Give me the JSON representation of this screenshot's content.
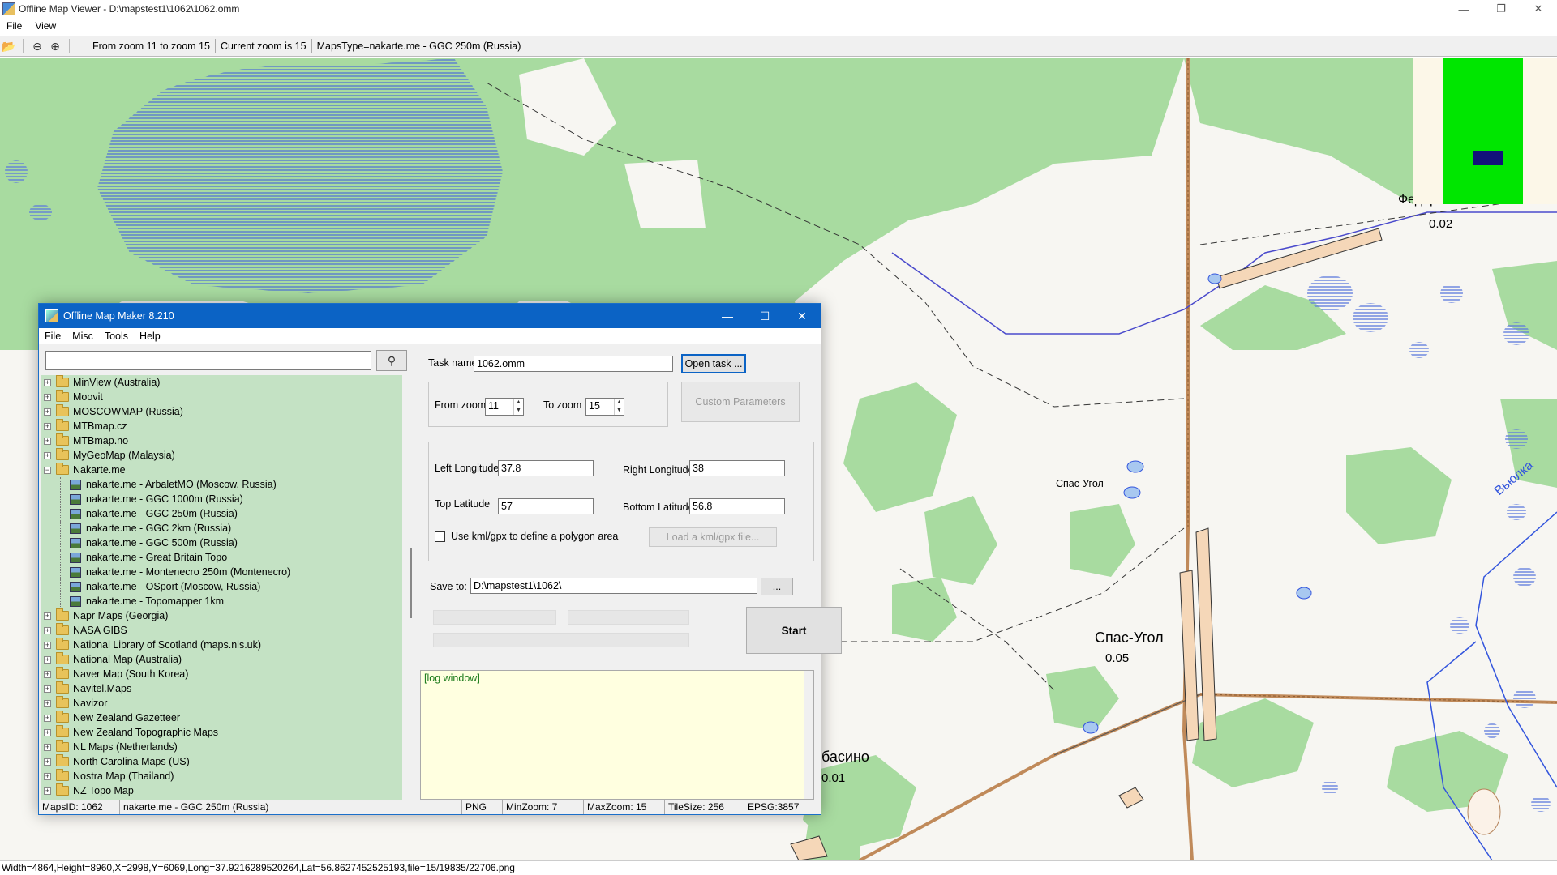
{
  "window": {
    "title": "Offline Map Viewer - D:\\mapstest1\\1062\\1062.omm",
    "controls": [
      "—",
      "❐",
      "✕"
    ]
  },
  "menu": [
    "File",
    "View"
  ],
  "toolbar": {
    "zoom_range": "From zoom 11 to zoom 15",
    "current_zoom": "Current zoom is 15",
    "maps_type": "MapsType=nakarte.me - GGC 250m (Russia)"
  },
  "status": "Width=4864,Height=8960,X=2998,Y=6069,Long=37.9216289520264,Lat=56.8627452525193,file=15/19835/22706.png",
  "map": {
    "labels": [
      {
        "text": "Федоровское"
      },
      {
        "text": "0.02"
      },
      {
        "text": "Спас-Угол"
      },
      {
        "text": "Спас-Угол"
      },
      {
        "text": "0.05"
      },
      {
        "text": "басино"
      },
      {
        "text": "0.01"
      },
      {
        "text": "Вьюлка"
      }
    ]
  },
  "dialog": {
    "title": "Offline Map Maker 8.210",
    "menu": [
      "File",
      "Misc",
      "Tools",
      "Help"
    ],
    "search_placeholder": "",
    "tree": [
      {
        "label": "MinView (Australia)",
        "type": "folder"
      },
      {
        "label": "Moovit",
        "type": "folder"
      },
      {
        "label": "MOSCOWMAP (Russia)",
        "type": "folder"
      },
      {
        "label": "MTBmap.cz",
        "type": "folder"
      },
      {
        "label": "MTBmap.no",
        "type": "folder"
      },
      {
        "label": "MyGeoMap (Malaysia)",
        "type": "folder"
      },
      {
        "label": "Nakarte.me",
        "type": "open"
      },
      {
        "label": "nakarte.me - ArbaletMO (Moscow, Russia)",
        "type": "map"
      },
      {
        "label": "nakarte.me - GGC 1000m (Russia)",
        "type": "map"
      },
      {
        "label": "nakarte.me - GGC 250m (Russia)",
        "type": "map"
      },
      {
        "label": "nakarte.me - GGC 2km (Russia)",
        "type": "map"
      },
      {
        "label": "nakarte.me - GGC 500m (Russia)",
        "type": "map"
      },
      {
        "label": "nakarte.me - Great Britain Topo",
        "type": "map"
      },
      {
        "label": "nakarte.me - Montenecro 250m (Montenecro)",
        "type": "map"
      },
      {
        "label": "nakarte.me - OSport (Moscow, Russia)",
        "type": "map"
      },
      {
        "label": "nakarte.me - Topomapper 1km",
        "type": "map"
      },
      {
        "label": "Napr Maps (Georgia)",
        "type": "folder"
      },
      {
        "label": "NASA GIBS",
        "type": "folder"
      },
      {
        "label": "National Library of Scotland (maps.nls.uk)",
        "type": "folder"
      },
      {
        "label": "National Map (Australia)",
        "type": "folder"
      },
      {
        "label": "Naver Map (South Korea)",
        "type": "folder"
      },
      {
        "label": "Navitel.Maps",
        "type": "folder"
      },
      {
        "label": "Navizor",
        "type": "folder"
      },
      {
        "label": "New Zealand Gazetteer",
        "type": "folder"
      },
      {
        "label": "New Zealand Topographic Maps",
        "type": "folder"
      },
      {
        "label": "NL Maps (Netherlands)",
        "type": "folder"
      },
      {
        "label": "North Carolina Maps (US)",
        "type": "folder"
      },
      {
        "label": "Nostra Map (Thailand)",
        "type": "folder"
      },
      {
        "label": "NZ Topo Map",
        "type": "folder"
      }
    ],
    "task_name_label": "Task name",
    "task_name_value": "1062.omm",
    "open_task": "Open task ...",
    "from_zoom_label": "From zoom",
    "from_zoom_value": "11",
    "to_zoom_label": "To zoom",
    "to_zoom_value": "15",
    "custom_params": "Custom Parameters",
    "left_lon_label": "Left Longitude",
    "left_lon_value": "37.8",
    "right_lon_label": "Right Longitude",
    "right_lon_value": "38",
    "top_lat_label": "Top Latitude",
    "top_lat_value": "57",
    "bottom_lat_label": "Bottom Latitude",
    "bottom_lat_value": "56.8",
    "kml_checkbox_label": "Use kml/gpx to define a polygon area",
    "kml_checked": false,
    "load_kml": "Load a kml/gpx file...",
    "save_to_label": "Save to:",
    "save_to_value": "D:\\mapstest1\\1062\\",
    "browse": "...",
    "start": "Start",
    "log": "[log window]",
    "status": {
      "maps_id": "MapsID: 1062",
      "map_name": "nakarte.me - GGC 250m (Russia)",
      "format": "PNG",
      "min_zoom": "MinZoom: 7",
      "max_zoom": "MaxZoom: 15",
      "tile_size": "TileSize: 256",
      "epsg": "EPSG:3857"
    }
  },
  "colors": {
    "forest": "#a8dba0",
    "water": "#4a6bd8",
    "road_brown": "#b5835a",
    "dialog_title": "#0b63c5",
    "tree_bg": "#c4e2c4",
    "log_bg": "#ffffe0",
    "minimap_green": "#00e600",
    "minimap_view": "#12127a"
  }
}
